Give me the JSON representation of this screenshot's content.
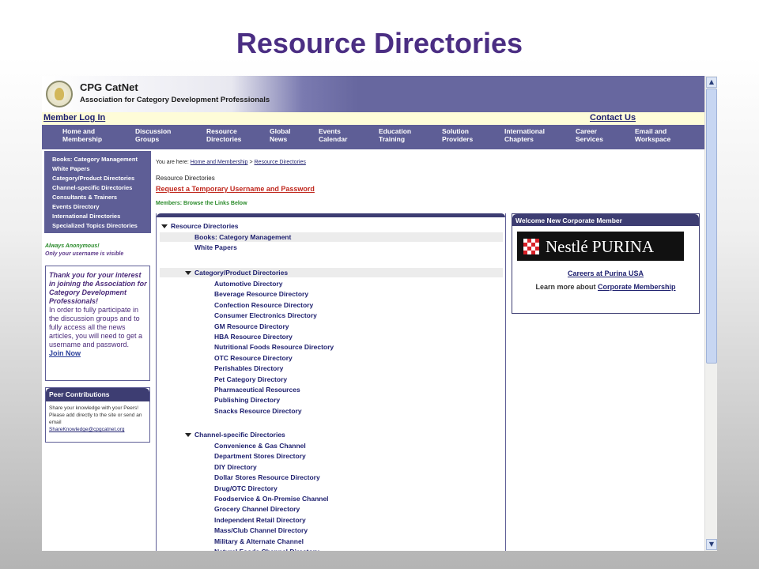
{
  "slide": {
    "title": "Resource Directories"
  },
  "header": {
    "site_name": "CPG CatNet",
    "site_subtitle": "Association for Category Development Professionals",
    "member_login": "Member Log In",
    "contact_us": "Contact Us"
  },
  "nav": [
    "Home and\nMembership",
    "Discussion\nGroups",
    "Resource\nDirectories",
    "Global\nNews",
    "Events\nCalendar",
    "Education\nTraining",
    "Solution\nProviders",
    "International\nChapters",
    "Career\nServices",
    "Email and\nWorkspace"
  ],
  "sidebar": {
    "items": [
      "Books: Category Management",
      "White Papers",
      "Category/Product Directories",
      "Channel-specific Directories",
      "Consultants & Trainers",
      "Events Directory",
      "International Directories",
      "Specialized Topics Directories"
    ],
    "anonymous_line1": "Always Anonymous!",
    "anonymous_line2": "Only your username is visible",
    "thanks_italic": "Thank you for your interest in joining the Association for Category Development Professionals!",
    "thanks_body": "In order to fully participate in the discussion groups and to fully access all the news articles, you will need to get a username and password.",
    "join_now": "Join Now",
    "peer_title": "Peer Contributions",
    "peer_text": "Share your knowledge with your Peers! Please add directly to the site or send an email",
    "peer_email": "ShareKnowledge@cpgcatnet.org"
  },
  "main": {
    "breadcrumb_prefix": "You are here:",
    "breadcrumb_home": "Home and Membership",
    "breadcrumb_sep": ">",
    "breadcrumb_current": "Resource Directories",
    "page_title": "Resource Directories",
    "temp_link": "Request a Temporary Username and Password",
    "members_note": "Members: Browse the Links Below",
    "tree": {
      "root": "Resource Directories",
      "top_items": [
        "Books: Category Management",
        "White Papers"
      ],
      "category_header": "Category/Product Directories",
      "category_items": [
        "Automotive Directory",
        "Beverage Resource Directory",
        "Confection Resource Directory",
        "Consumer Electronics Directory",
        "GM Resource Directory",
        "HBA Resource Directory",
        "Nutritional Foods Resource Directory",
        "OTC Resource Directory",
        "Perishables Directory",
        "Pet Category Directory",
        "Pharmaceutical Resources",
        "Publishing Directory",
        "Snacks Resource Directory"
      ],
      "channel_header": "Channel-specific Directories",
      "channel_items": [
        "Convenience & Gas Channel",
        "Department Stores Directory",
        "DIY Directory",
        "Dollar Stores Resource Directory",
        "Drug/OTC Directory",
        "Foodservice & On-Premise Channel",
        "Grocery Channel Directory",
        "Independent Retail Directory",
        "Mass/Club Channel Directory",
        "Military & Alternate Channel",
        "Natural Foods Channel Directory"
      ]
    }
  },
  "right": {
    "welcome_title": "Welcome New Corporate Member",
    "logo_text": "Nestlé PURINA",
    "careers_link": "Careers at Purina USA",
    "learn_prefix": "Learn more about",
    "learn_link": "Corporate Membership"
  },
  "colors": {
    "title_purple": "#4b2e83",
    "nav_purple": "#5e5e96",
    "link_blue": "#1d1f6e",
    "alert_red": "#c0281e",
    "note_green": "#2a8a2a"
  }
}
